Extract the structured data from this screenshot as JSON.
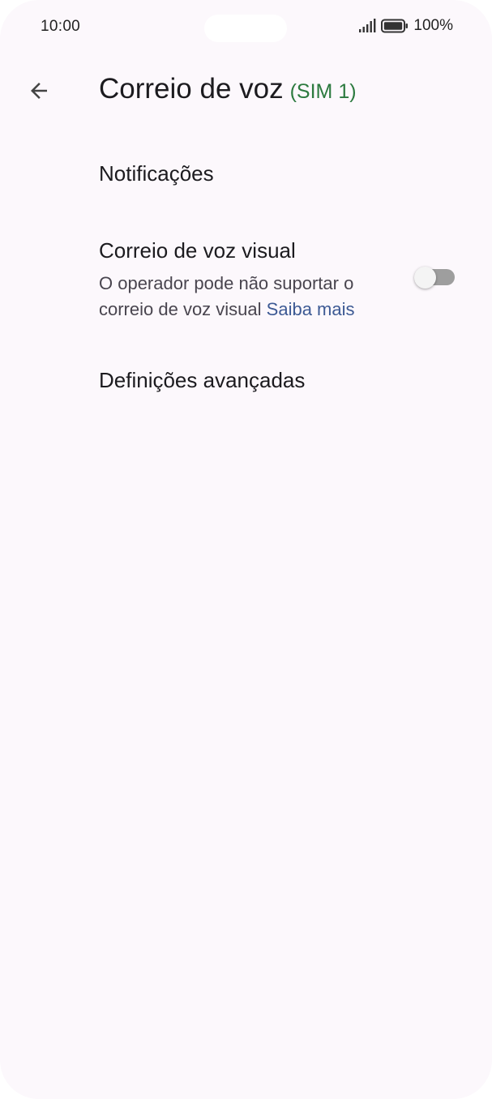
{
  "status_bar": {
    "time": "10:00",
    "battery": "100%",
    "signal_icon": "signal-icon",
    "battery_icon": "battery-icon"
  },
  "app_bar": {
    "back_icon": "arrow-back-icon",
    "title": "Correio de voz",
    "subtitle": "(SIM 1)"
  },
  "settings": {
    "notifications": {
      "label": "Notificações"
    },
    "visual_voicemail": {
      "label": "Correio de voz visual",
      "summary": "O operador pode não suportar o correio de voz visual",
      "learn_more": "Saiba mais",
      "enabled": false
    },
    "advanced": {
      "label": "Definições avançadas"
    }
  },
  "colors": {
    "background": "#fcf8fc",
    "sim_label": "#2c7a3f",
    "link": "#3d5a94",
    "switch_track_off": "#9e9e9e"
  }
}
